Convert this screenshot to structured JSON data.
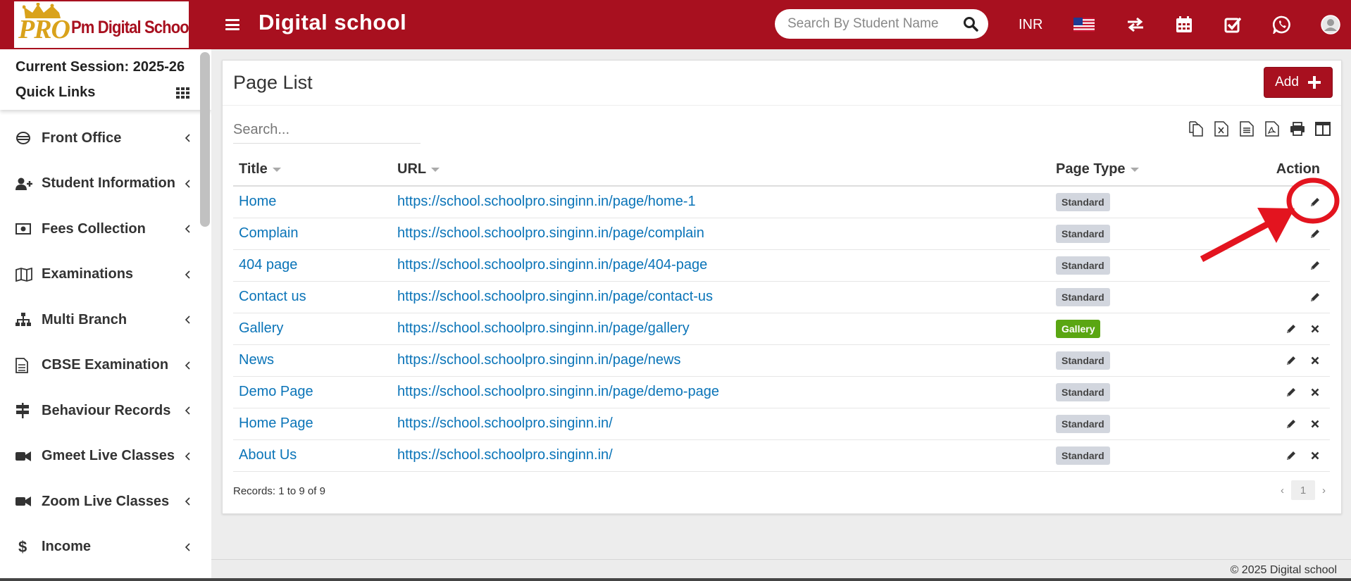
{
  "header": {
    "logo_pro": "PRO",
    "logo_name": "Pm Digital School",
    "app_title": "Digital school",
    "search_placeholder": "Search By Student Name",
    "currency": "INR",
    "icons": [
      "menu-icon",
      "search-icon",
      "us-flag-icon",
      "switch-arrows-icon",
      "calendar-icon",
      "checkbox-icon",
      "whatsapp-icon",
      "user-avatar-icon"
    ]
  },
  "sidebar": {
    "session": "Current Session: 2025-26",
    "quick_links": "Quick Links",
    "items": [
      {
        "label": "Front Office",
        "icon": "front-office-icon"
      },
      {
        "label": "Student Information",
        "icon": "user-plus-icon"
      },
      {
        "label": "Fees Collection",
        "icon": "money-icon"
      },
      {
        "label": "Examinations",
        "icon": "map-icon"
      },
      {
        "label": "Multi Branch",
        "icon": "sitemap-icon"
      },
      {
        "label": "CBSE Examination",
        "icon": "document-icon"
      },
      {
        "label": "Behaviour Records",
        "icon": "signpost-icon"
      },
      {
        "label": "Gmeet Live Classes",
        "icon": "video-camera-icon"
      },
      {
        "label": "Zoom Live Classes",
        "icon": "video-camera-icon"
      },
      {
        "label": "Income",
        "icon": "dollar-icon"
      }
    ]
  },
  "page": {
    "title": "Page List",
    "add_label": "Add",
    "search_placeholder": "Search...",
    "columns": {
      "title": "Title",
      "url": "URL",
      "page_type": "Page Type",
      "action": "Action"
    },
    "rows": [
      {
        "title": "Home",
        "url": "https://school.schoolpro.singinn.in/page/home-1",
        "type": "Standard",
        "deletable": false
      },
      {
        "title": "Complain",
        "url": "https://school.schoolpro.singinn.in/page/complain",
        "type": "Standard",
        "deletable": false
      },
      {
        "title": "404 page",
        "url": "https://school.schoolpro.singinn.in/page/404-page",
        "type": "Standard",
        "deletable": false
      },
      {
        "title": "Contact us",
        "url": "https://school.schoolpro.singinn.in/page/contact-us",
        "type": "Standard",
        "deletable": false
      },
      {
        "title": "Gallery",
        "url": "https://school.schoolpro.singinn.in/page/gallery",
        "type": "Gallery",
        "deletable": true
      },
      {
        "title": "News",
        "url": "https://school.schoolpro.singinn.in/page/news",
        "type": "Standard",
        "deletable": true
      },
      {
        "title": "Demo Page",
        "url": "https://school.schoolpro.singinn.in/page/demo-page",
        "type": "Standard",
        "deletable": true
      },
      {
        "title": "Home Page",
        "url": "https://school.schoolpro.singinn.in/",
        "type": "Standard",
        "deletable": true
      },
      {
        "title": "About Us",
        "url": "https://school.schoolpro.singinn.in/",
        "type": "Standard",
        "deletable": true
      }
    ],
    "records": "Records: 1 to 9 of 9",
    "current_page": "1",
    "pager_prev": "‹",
    "pager_next": "›"
  },
  "footer": {
    "text": "© 2025 Digital school"
  },
  "colors": {
    "brand": "#a8101f",
    "link": "#0a74b8",
    "annotation": "#e3141f",
    "gallery_badge": "#5aa612"
  }
}
